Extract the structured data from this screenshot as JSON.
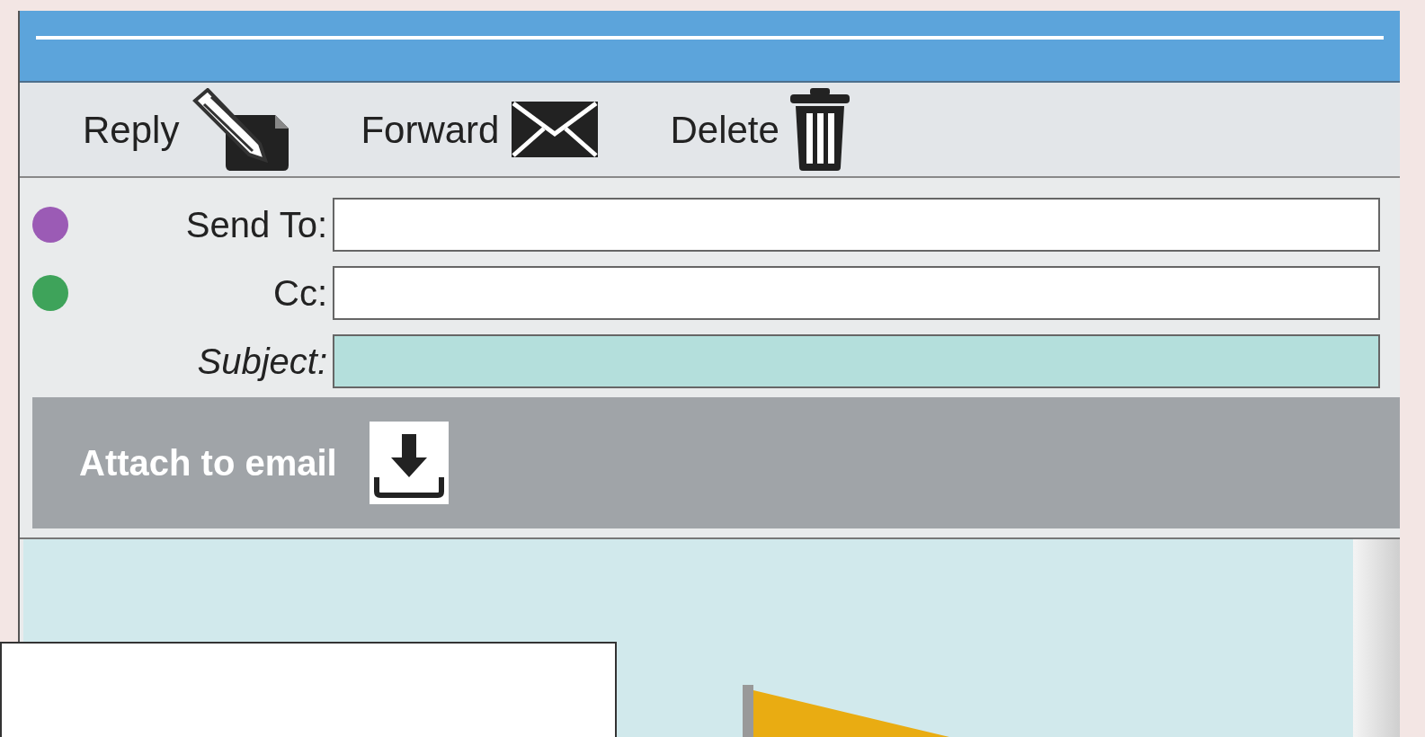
{
  "toolbar": [
    {
      "label": "Reply",
      "kind": "reply"
    },
    {
      "label": "Forward",
      "kind": "forward"
    },
    {
      "label": "Delete",
      "kind": "delete"
    }
  ],
  "fields": [
    {
      "label": "Send To:",
      "color": "#9b5bb5",
      "italic": false,
      "highlighted": false
    },
    {
      "label": "Cc:",
      "color": "#3ea35a",
      "italic": false,
      "highlighted": false
    },
    {
      "label": "Subject:",
      "italic": true,
      "highlighted": true
    }
  ],
  "attach": {
    "label": "Attach to email"
  }
}
